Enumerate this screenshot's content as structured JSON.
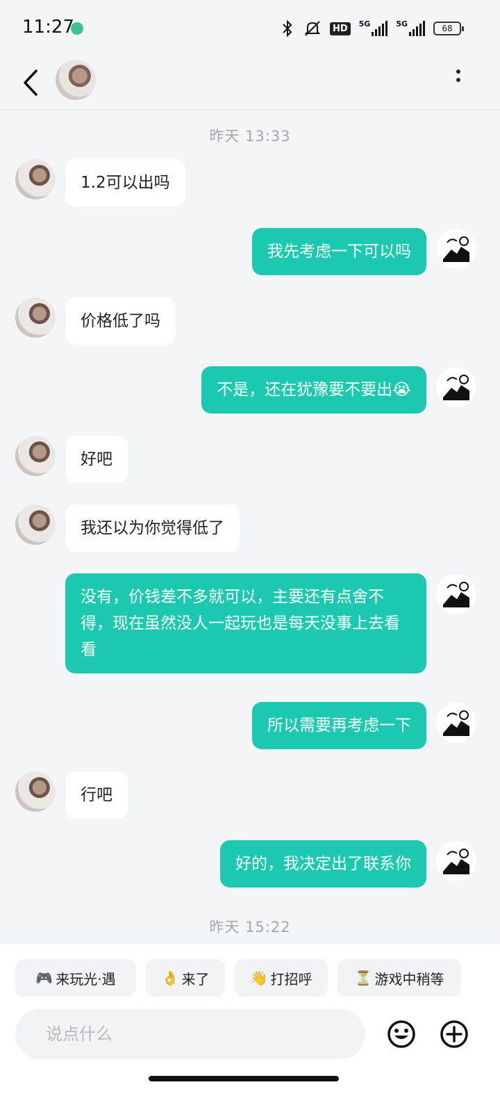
{
  "status_bar": {
    "time": "11:27",
    "network_label": "5G",
    "network_label_2": "5G",
    "hd_label": "HD",
    "battery": "68"
  },
  "colors": {
    "accent": "#1dc8b0",
    "background": "#f4f5f7",
    "incoming_bubble": "#ffffff",
    "timestamp": "#a4a6ab"
  },
  "chat": {
    "timestamp_1": "昨天  13:33",
    "timestamp_2": "昨天  15:22",
    "messages": [
      {
        "side": "in",
        "text": "1.2可以出吗"
      },
      {
        "side": "out",
        "text": "我先考虑一下可以吗"
      },
      {
        "side": "in",
        "text": "价格低了吗"
      },
      {
        "side": "out",
        "text": "不是，还在犹豫要不要出😭"
      },
      {
        "side": "in",
        "text": "好吧"
      },
      {
        "side": "in",
        "text": "我还以为你觉得低了"
      },
      {
        "side": "out",
        "text": "没有，价钱差不多就可以，主要还有点舍不得，现在虽然没人一起玩也是每天没事上去看看"
      },
      {
        "side": "out",
        "text": "所以需要再考虑一下"
      },
      {
        "side": "in",
        "text": "行吧"
      },
      {
        "side": "out",
        "text": "好的，我决定出了联系你"
      }
    ]
  },
  "quick_replies": [
    {
      "emoji": "🎮",
      "label": "来玩光·遇"
    },
    {
      "emoji": "👌",
      "label": "来了"
    },
    {
      "emoji": "👋",
      "label": "打招呼"
    },
    {
      "emoji": "⏳",
      "label": "游戏中稍等"
    }
  ],
  "composer": {
    "placeholder": "说点什么",
    "emoji_icon": "smiley-icon",
    "add_icon": "plus-circle-icon"
  }
}
